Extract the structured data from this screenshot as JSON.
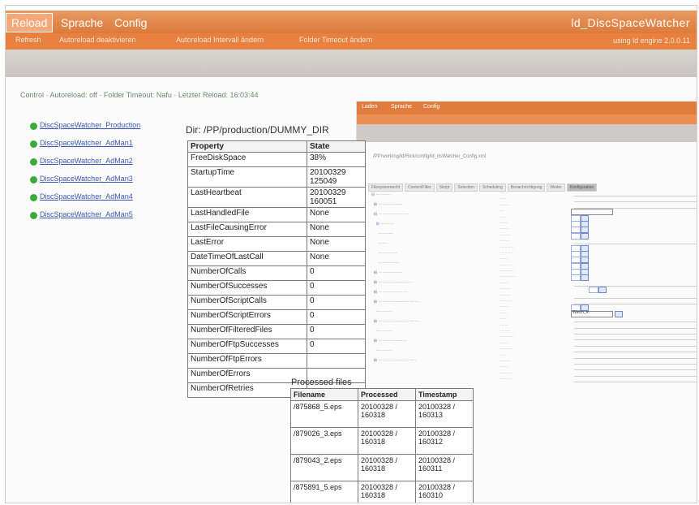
{
  "topbar": {
    "tabs": [
      "Reload",
      "Sprache",
      "Config"
    ],
    "active_tab": "Reload",
    "app_title": "ld_DiscSpaceWatcher"
  },
  "subnav": {
    "links": [
      "Refresh",
      "Autoreload deaktivieren",
      "Autoreload Intervall ändern",
      "Folder Timeout ändern"
    ],
    "version": "using ld engine 2.0.0.11"
  },
  "status_line": "Control · Autoreload: off · Folder Timeout: Nafu · Letzter Reload: 16:03:44",
  "nav_items": [
    "DiscSpaceWatcher_Production",
    "DiscSpaceWatcher_AdMan1",
    "DiscSpaceWatcher_AdMan2",
    "DiscSpaceWatcher_AdMan3",
    "DiscSpaceWatcher_AdMan4",
    "DiscSpaceWatcher_AdMan5"
  ],
  "dir_title": "Dir: /PP/production/DUMMY_DIR",
  "property_table": {
    "headers": [
      "Property",
      "State"
    ],
    "rows": [
      [
        "FreeDiskSpace",
        "38%"
      ],
      [
        "StartupTime",
        "20100329 125049"
      ],
      [
        "LastHeartbeat",
        "20100329 160051"
      ],
      [
        "LastHandledFile",
        "None"
      ],
      [
        "LastFileCausingError",
        "None"
      ],
      [
        "LastError",
        "None"
      ],
      [
        "DateTimeOfLastCall",
        "None"
      ],
      [
        "NumberOfCalls",
        "0"
      ],
      [
        "NumberOfSuccesses",
        "0"
      ],
      [
        "NumberOfScriptCalls",
        "0"
      ],
      [
        "NumberOfScriptErrors",
        "0"
      ],
      [
        "NumberOfFilteredFiles",
        "0"
      ],
      [
        "NumberOfFtpSuccesses",
        "0"
      ],
      [
        "NumberOfFtpErrors",
        ""
      ],
      [
        "NumberOfErrors",
        ""
      ],
      [
        "NumberOfRetries",
        ""
      ]
    ]
  },
  "processed_files": {
    "title": "Processed files",
    "headers": [
      "Filename",
      "Processed",
      "Timestamp"
    ],
    "rows": [
      [
        "/875868_5.eps",
        "20100328 / 160318",
        "20100328 / 160313"
      ],
      [
        "/879026_3.eps",
        "20100328 / 160318",
        "20100328 / 160312"
      ],
      [
        "/879043_2.eps",
        "20100328 / 160318",
        "20100328 / 160311"
      ],
      [
        "/875891_5.eps",
        "20100328 / 160318",
        "20100328 / 160310"
      ]
    ]
  },
  "overlay_window": {
    "tabs": [
      "Laden",
      "Sprache",
      "Config"
    ],
    "path": "/PP/working/ld/Rick/config/ld_dsWatcher_Config.xml",
    "detail_tabs": [
      "Filesystemrecht",
      "ContentFilter",
      "Skript",
      "Selection",
      "Scheduling",
      "Benachrichtigung",
      "Weiter",
      "Konfiguration"
    ],
    "combo_value": "Watch_in"
  },
  "colors": {
    "header_orange": "#de7a3c",
    "subnav_orange": "#e8813f",
    "link_blue": "#3a59b8",
    "status_green": "#3aaa3a"
  }
}
